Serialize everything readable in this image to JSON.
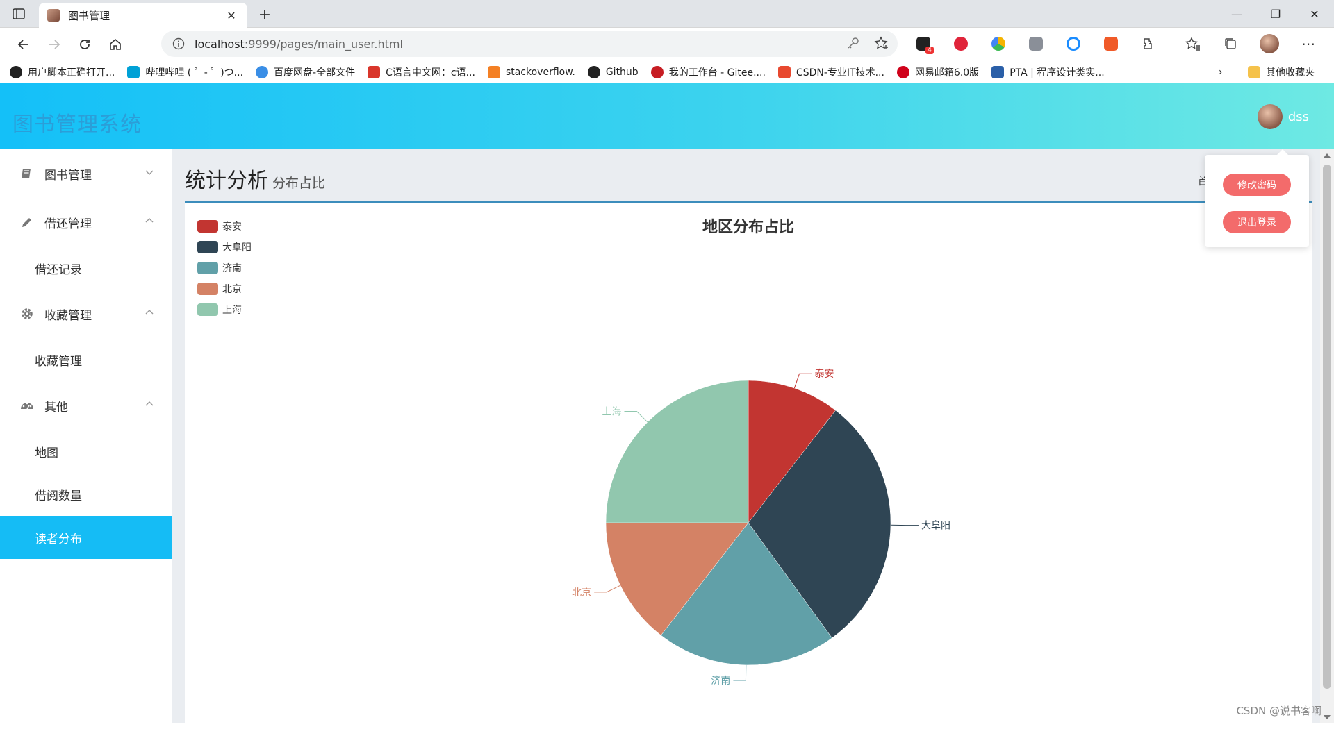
{
  "browser": {
    "tab_title": "图书管理",
    "url_host": "localhost",
    "url_rest": ":9999/pages/main_user.html",
    "extension_badge": "4",
    "bookmarks": [
      {
        "label": "用户脚本正确打开...",
        "color": "#222222"
      },
      {
        "label": "哔哩哔哩 ( ゜- ゜)つ...",
        "color": "#00a1d6"
      },
      {
        "label": "百度网盘-全部文件",
        "color": "#3a8ee6"
      },
      {
        "label": "C语言中文网：c语...",
        "color": "#d9362b"
      },
      {
        "label": "stackoverflow.",
        "color": "#f48024"
      },
      {
        "label": "Github",
        "color": "#222222"
      },
      {
        "label": "我的工作台 - Gitee....",
        "color": "#c71d23"
      },
      {
        "label": "CSDN-专业IT技术...",
        "color": "#e8492f"
      },
      {
        "label": "网易邮箱6.0版",
        "color": "#d0021b"
      },
      {
        "label": "PTA | 程序设计类实...",
        "color": "#2a5fa8"
      }
    ],
    "other_bookmarks": "其他收藏夹"
  },
  "app": {
    "title": "图书管理系统",
    "username": "dss"
  },
  "sidebar": {
    "groups": [
      {
        "label": "图书管理",
        "icon": "book-icon",
        "expanded": false,
        "items": []
      },
      {
        "label": "借还管理",
        "icon": "pencil-icon",
        "expanded": true,
        "items": [
          "借还记录"
        ]
      },
      {
        "label": "收藏管理",
        "icon": "gear-icon",
        "expanded": true,
        "items": [
          "收藏管理"
        ]
      },
      {
        "label": "其他",
        "icon": "dashboard-icon",
        "expanded": true,
        "items": [
          "地图",
          "借阅数量",
          "读者分布"
        ]
      }
    ],
    "active_item": "读者分布"
  },
  "page": {
    "title": "统计分析",
    "subtitle": "分布占比",
    "breadcrumb_fragment": "首"
  },
  "dropdown": {
    "change_password": "修改密码",
    "logout": "退出登录"
  },
  "chart_data": {
    "type": "pie",
    "title": "地区分布占比",
    "legend_position": "top-left",
    "start_angle_deg": 90,
    "clockwise": true,
    "slices": [
      {
        "name": "泰安",
        "value": 10.5,
        "color": "#c23531"
      },
      {
        "name": "大阜阳",
        "value": 29.5,
        "color": "#2f4554"
      },
      {
        "name": "济南",
        "value": 20.5,
        "color": "#61a0a8"
      },
      {
        "name": "北京",
        "value": 14.5,
        "color": "#d48265"
      },
      {
        "name": "上海",
        "value": 25.0,
        "color": "#91c7ae"
      }
    ]
  },
  "watermark": "CSDN @说书客啊"
}
